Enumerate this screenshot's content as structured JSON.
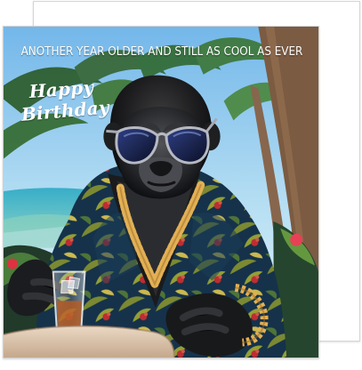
{
  "card": {
    "headline": "ANOTHER YEAR OLDER AND STILL AS COOL AS EVER",
    "greeting_line_1": "Happy",
    "greeting_line_2": "Birthday",
    "illustration_name": "gorilla-illustration"
  },
  "colors": {
    "sky": "#8dc9ef",
    "sea": "#45aeb5",
    "shirt": "#173650",
    "gold": "#d9a747",
    "table": "#dcc7b1"
  }
}
